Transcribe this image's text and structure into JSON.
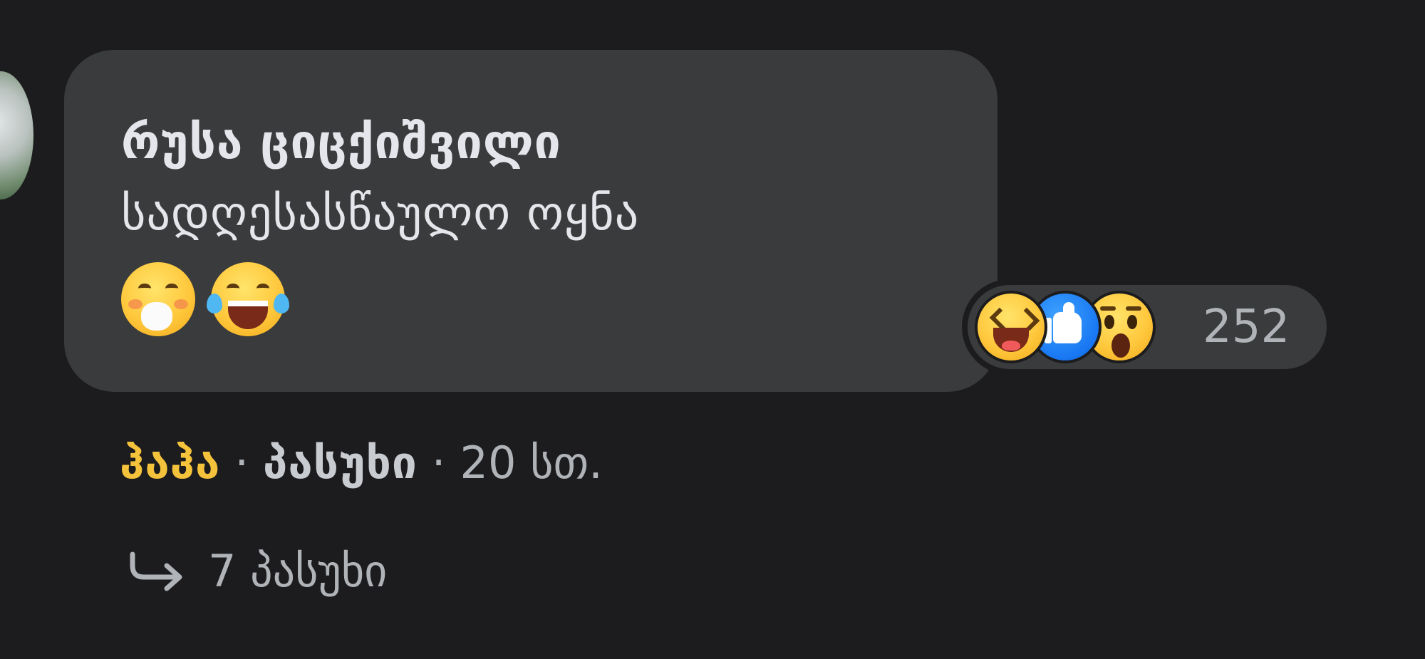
{
  "comment": {
    "author": "რუსა ციცქიშვილი",
    "text": "სადღესასწაულო ოყნა",
    "emojis": [
      "flushed-face-hand-over-mouth-emoji",
      "tears-of-joy-emoji"
    ]
  },
  "reactions": {
    "icons": [
      "haha-reaction-icon",
      "like-reaction-icon",
      "wow-reaction-icon"
    ],
    "count": "252"
  },
  "actions": {
    "like_label": "ჰაჰა",
    "reply_label": "პასუხი",
    "separator": "·",
    "timestamp": "20 სთ."
  },
  "replies": {
    "label": "7 პასუხი"
  },
  "colors": {
    "background": "#1c1c1e",
    "bubble": "#3a3b3c",
    "text": "#e4e6eb",
    "muted": "#b0b3b8",
    "like_active": "#f5c33b",
    "like_blue": "#1877f2"
  }
}
